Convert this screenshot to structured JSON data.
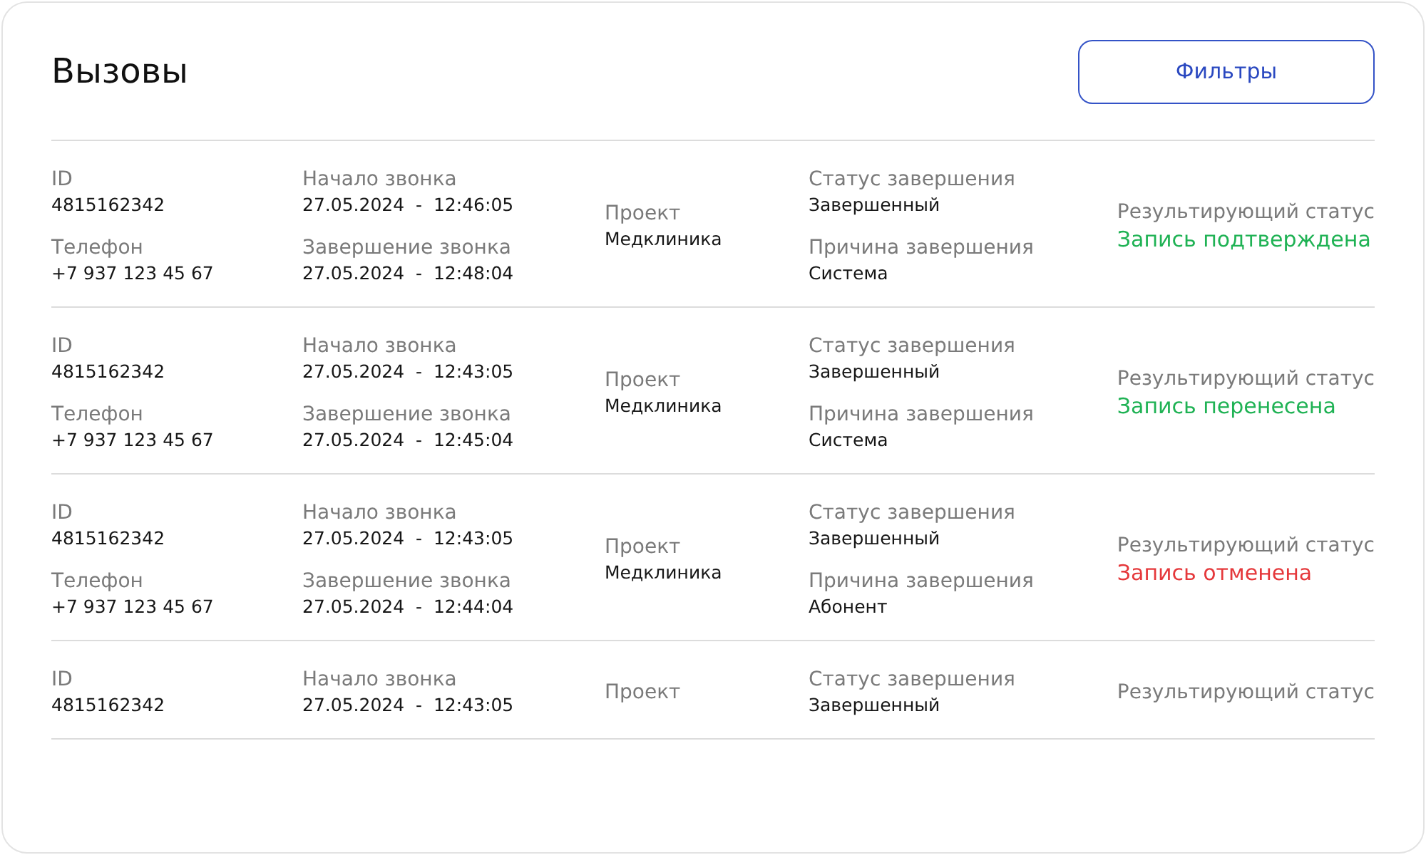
{
  "title": "Вызовы",
  "filter_button": "Фильтры",
  "rows": [
    {
      "id_label": "ID",
      "id": "4815162342",
      "phone_label": "Телефон",
      "phone": "+7 937 123 45 67",
      "start_label": "Начало звонка",
      "start": "27.05.2024  -  12:46:05",
      "end_label": "Завершение звонка",
      "end": "27.05.2024  -  12:48:04",
      "project_label": "Проект",
      "project": "Медклиника",
      "end_status_label": "Статус завершения",
      "end_status": "Завершенный",
      "reason_label": "Причина завершения",
      "reason": "Система",
      "result_label": "Результирующий статус",
      "result": "Запись подтверждена",
      "color": "#1fb254"
    },
    {
      "id_label": "ID",
      "id": "4815162342",
      "phone_label": "Телефон",
      "phone": "+7 937 123 45 67",
      "start_label": "Начало звонка",
      "start": "27.05.2024  -  12:43:05",
      "end_label": "Завершение звонка",
      "end": "27.05.2024  -  12:45:04",
      "project_label": "Проект",
      "project": "Медклиника",
      "end_status_label": "Статус завершения",
      "end_status": "Завершенный",
      "reason_label": "Причина завершения",
      "reason": "Система",
      "result_label": "Результирующий статус",
      "result": "Запись перенесена",
      "color": "#1fb254"
    },
    {
      "id_label": "ID",
      "id": "4815162342",
      "phone_label": "Телефон",
      "phone": "+7 937 123 45 67",
      "start_label": "Начало звонка",
      "start": "27.05.2024  -  12:43:05",
      "end_label": "Завершение звонка",
      "end": "27.05.2024  -  12:44:04",
      "project_label": "Проект",
      "project": "Медклиника",
      "end_status_label": "Статус завершения",
      "end_status": "Завершенный",
      "reason_label": "Причина завершения",
      "reason": "Абонент",
      "result_label": "Результирующий статус",
      "result": "Запись отменена",
      "color": "#e5383b"
    },
    {
      "id_label": "ID",
      "id": "4815162342",
      "start_label": "Начало звонка",
      "start": "27.05.2024  -  12:43:05",
      "project_label": "Проект",
      "end_status_label": "Статус завершения",
      "end_status": "Завершенный",
      "result_label": "Результирующий статус"
    }
  ]
}
